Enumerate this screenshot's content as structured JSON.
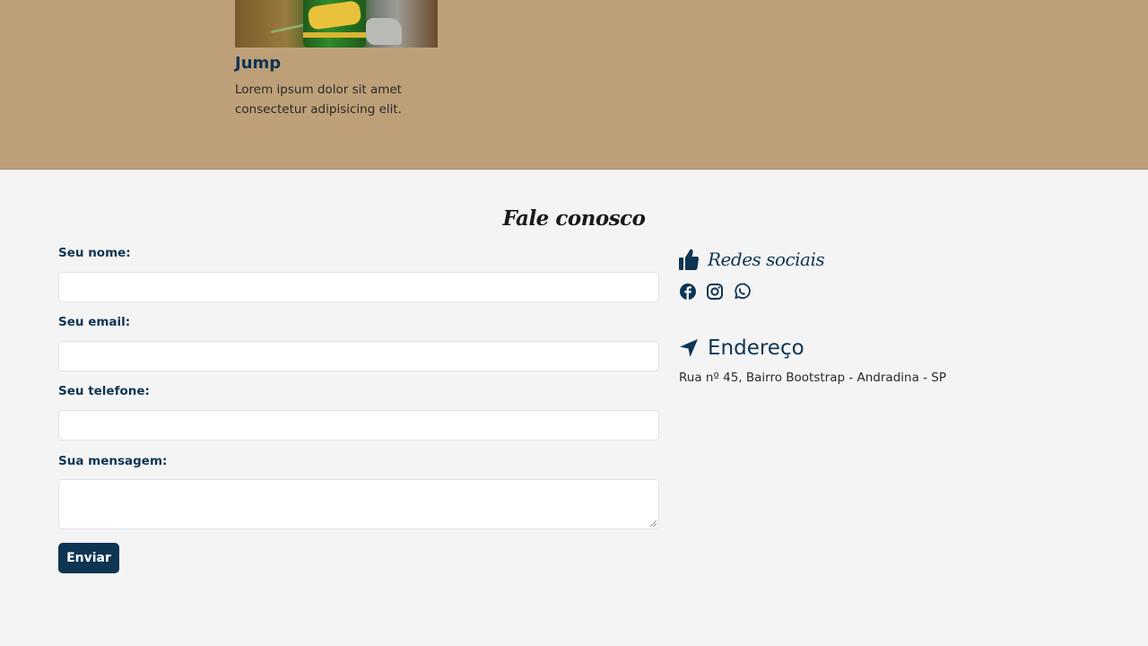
{
  "product": {
    "title": "Jump",
    "description": "Lorem ipsum dolor sit amet consectetur adipisicing elit.",
    "image_label": "Jump"
  },
  "contact": {
    "title": "Fale conosco",
    "form": {
      "name_label": "Seu nome:",
      "name_value": "",
      "email_label": "Seu email:",
      "email_value": "",
      "phone_label": "Seu telefone:",
      "phone_value": "",
      "message_label": "Sua mensagem:",
      "message_value": "",
      "submit_label": "Enviar"
    },
    "social": {
      "heading": "Redes sociais",
      "heading_icon": "thumbs-up-icon",
      "icons": [
        "facebook-icon",
        "instagram-icon",
        "whatsapp-icon"
      ]
    },
    "address": {
      "heading": "Endereço",
      "heading_icon": "location-arrow-icon",
      "text": "Rua nº 45, Bairro Bootstrap - Andradina - SP"
    }
  },
  "colors": {
    "band_background": "#bda078",
    "page_background": "#f4f4f4",
    "primary": "#0e3553"
  }
}
